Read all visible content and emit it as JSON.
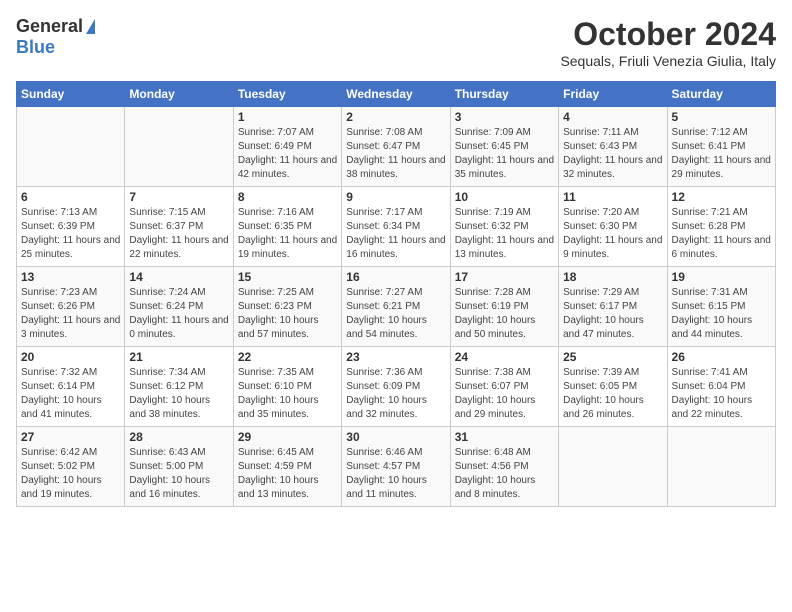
{
  "logo": {
    "general": "General",
    "blue": "Blue"
  },
  "title": "October 2024",
  "location": "Sequals, Friuli Venezia Giulia, Italy",
  "headers": [
    "Sunday",
    "Monday",
    "Tuesday",
    "Wednesday",
    "Thursday",
    "Friday",
    "Saturday"
  ],
  "weeks": [
    [
      {
        "day": "",
        "detail": ""
      },
      {
        "day": "",
        "detail": ""
      },
      {
        "day": "1",
        "detail": "Sunrise: 7:07 AM\nSunset: 6:49 PM\nDaylight: 11 hours and 42 minutes."
      },
      {
        "day": "2",
        "detail": "Sunrise: 7:08 AM\nSunset: 6:47 PM\nDaylight: 11 hours and 38 minutes."
      },
      {
        "day": "3",
        "detail": "Sunrise: 7:09 AM\nSunset: 6:45 PM\nDaylight: 11 hours and 35 minutes."
      },
      {
        "day": "4",
        "detail": "Sunrise: 7:11 AM\nSunset: 6:43 PM\nDaylight: 11 hours and 32 minutes."
      },
      {
        "day": "5",
        "detail": "Sunrise: 7:12 AM\nSunset: 6:41 PM\nDaylight: 11 hours and 29 minutes."
      }
    ],
    [
      {
        "day": "6",
        "detail": "Sunrise: 7:13 AM\nSunset: 6:39 PM\nDaylight: 11 hours and 25 minutes."
      },
      {
        "day": "7",
        "detail": "Sunrise: 7:15 AM\nSunset: 6:37 PM\nDaylight: 11 hours and 22 minutes."
      },
      {
        "day": "8",
        "detail": "Sunrise: 7:16 AM\nSunset: 6:35 PM\nDaylight: 11 hours and 19 minutes."
      },
      {
        "day": "9",
        "detail": "Sunrise: 7:17 AM\nSunset: 6:34 PM\nDaylight: 11 hours and 16 minutes."
      },
      {
        "day": "10",
        "detail": "Sunrise: 7:19 AM\nSunset: 6:32 PM\nDaylight: 11 hours and 13 minutes."
      },
      {
        "day": "11",
        "detail": "Sunrise: 7:20 AM\nSunset: 6:30 PM\nDaylight: 11 hours and 9 minutes."
      },
      {
        "day": "12",
        "detail": "Sunrise: 7:21 AM\nSunset: 6:28 PM\nDaylight: 11 hours and 6 minutes."
      }
    ],
    [
      {
        "day": "13",
        "detail": "Sunrise: 7:23 AM\nSunset: 6:26 PM\nDaylight: 11 hours and 3 minutes."
      },
      {
        "day": "14",
        "detail": "Sunrise: 7:24 AM\nSunset: 6:24 PM\nDaylight: 11 hours and 0 minutes."
      },
      {
        "day": "15",
        "detail": "Sunrise: 7:25 AM\nSunset: 6:23 PM\nDaylight: 10 hours and 57 minutes."
      },
      {
        "day": "16",
        "detail": "Sunrise: 7:27 AM\nSunset: 6:21 PM\nDaylight: 10 hours and 54 minutes."
      },
      {
        "day": "17",
        "detail": "Sunrise: 7:28 AM\nSunset: 6:19 PM\nDaylight: 10 hours and 50 minutes."
      },
      {
        "day": "18",
        "detail": "Sunrise: 7:29 AM\nSunset: 6:17 PM\nDaylight: 10 hours and 47 minutes."
      },
      {
        "day": "19",
        "detail": "Sunrise: 7:31 AM\nSunset: 6:15 PM\nDaylight: 10 hours and 44 minutes."
      }
    ],
    [
      {
        "day": "20",
        "detail": "Sunrise: 7:32 AM\nSunset: 6:14 PM\nDaylight: 10 hours and 41 minutes."
      },
      {
        "day": "21",
        "detail": "Sunrise: 7:34 AM\nSunset: 6:12 PM\nDaylight: 10 hours and 38 minutes."
      },
      {
        "day": "22",
        "detail": "Sunrise: 7:35 AM\nSunset: 6:10 PM\nDaylight: 10 hours and 35 minutes."
      },
      {
        "day": "23",
        "detail": "Sunrise: 7:36 AM\nSunset: 6:09 PM\nDaylight: 10 hours and 32 minutes."
      },
      {
        "day": "24",
        "detail": "Sunrise: 7:38 AM\nSunset: 6:07 PM\nDaylight: 10 hours and 29 minutes."
      },
      {
        "day": "25",
        "detail": "Sunrise: 7:39 AM\nSunset: 6:05 PM\nDaylight: 10 hours and 26 minutes."
      },
      {
        "day": "26",
        "detail": "Sunrise: 7:41 AM\nSunset: 6:04 PM\nDaylight: 10 hours and 22 minutes."
      }
    ],
    [
      {
        "day": "27",
        "detail": "Sunrise: 6:42 AM\nSunset: 5:02 PM\nDaylight: 10 hours and 19 minutes."
      },
      {
        "day": "28",
        "detail": "Sunrise: 6:43 AM\nSunset: 5:00 PM\nDaylight: 10 hours and 16 minutes."
      },
      {
        "day": "29",
        "detail": "Sunrise: 6:45 AM\nSunset: 4:59 PM\nDaylight: 10 hours and 13 minutes."
      },
      {
        "day": "30",
        "detail": "Sunrise: 6:46 AM\nSunset: 4:57 PM\nDaylight: 10 hours and 11 minutes."
      },
      {
        "day": "31",
        "detail": "Sunrise: 6:48 AM\nSunset: 4:56 PM\nDaylight: 10 hours and 8 minutes."
      },
      {
        "day": "",
        "detail": ""
      },
      {
        "day": "",
        "detail": ""
      }
    ]
  ]
}
